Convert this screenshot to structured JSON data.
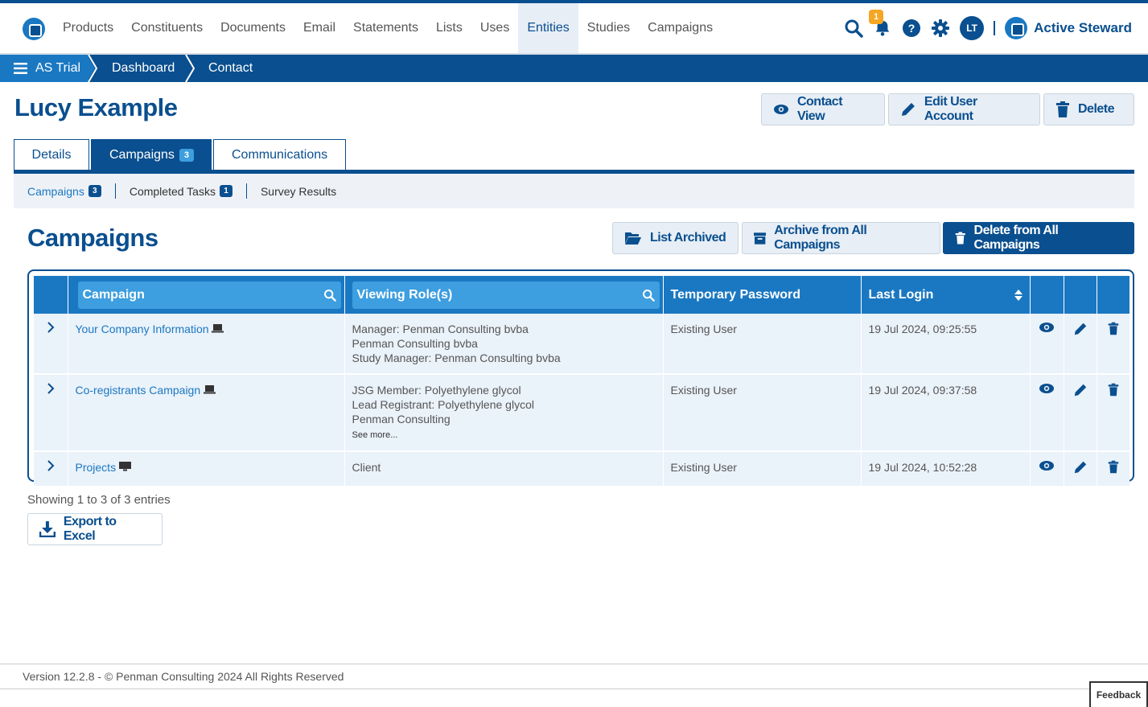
{
  "nav": {
    "items": [
      "Products",
      "Constituents",
      "Documents",
      "Email",
      "Statements",
      "Lists",
      "Uses",
      "Entities",
      "Studies",
      "Campaigns"
    ],
    "active": "Entities",
    "notification_count": "1",
    "user_initials": "LT",
    "brand": "Active Steward"
  },
  "breadcrumb": {
    "root": "AS Trial",
    "level1": "Dashboard",
    "level2": "Contact"
  },
  "page": {
    "title": "Lucy Example"
  },
  "actions": {
    "contact_view": "Contact View",
    "edit_user_account": "Edit User Account",
    "delete": "Delete"
  },
  "tabs": [
    {
      "label": "Details"
    },
    {
      "label": "Campaigns",
      "count": "3"
    },
    {
      "label": "Communications"
    }
  ],
  "subtabs": [
    {
      "label": "Campaigns",
      "count": "3"
    },
    {
      "label": "Completed Tasks",
      "count": "1"
    },
    {
      "label": "Survey Results"
    }
  ],
  "section": {
    "title": "Campaigns",
    "list_archived": "List Archived",
    "archive_all": "Archive from All Campaigns",
    "delete_all": "Delete from All Campaigns"
  },
  "table": {
    "headers": {
      "campaign": "Campaign",
      "viewing_roles": "Viewing Role(s)",
      "temp_password": "Temporary Password",
      "last_login": "Last Login"
    },
    "rows": [
      {
        "campaign": "Your Company Information",
        "roles": [
          "Manager: Penman Consulting bvba",
          "Penman Consulting bvba",
          "Study Manager: Penman Consulting bvba"
        ],
        "see_more": "",
        "password": "Existing User",
        "last_login": "19 Jul 2024, 09:25:55"
      },
      {
        "campaign": "Co-registrants Campaign",
        "roles": [
          "JSG Member: Polyethylene glycol",
          "Lead Registrant: Polyethylene glycol",
          "Penman Consulting"
        ],
        "see_more": "See more...",
        "password": "Existing User",
        "last_login": "19 Jul 2024, 09:37:58"
      },
      {
        "campaign": "Projects",
        "roles": [
          "Client"
        ],
        "see_more": "",
        "password": "Existing User",
        "last_login": "19 Jul 2024, 10:52:28"
      }
    ]
  },
  "entries": "Showing 1 to 3 of 3 entries",
  "export": "Export to Excel",
  "footer": "Version 12.2.8 - © Penman Consulting 2024 All Rights Reserved",
  "feedback": "Feedback"
}
